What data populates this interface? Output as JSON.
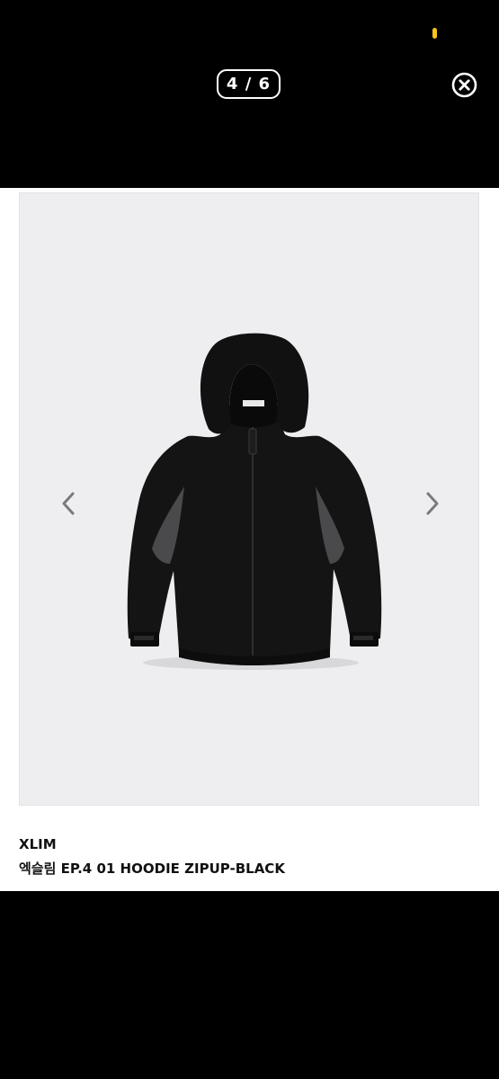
{
  "viewer": {
    "counter": "4 / 6",
    "current_index": 4,
    "total_images": 6
  },
  "icons": {
    "close": "close-circle-icon",
    "prev": "chevron-left-icon",
    "next": "chevron-right-icon",
    "product_image": "black-hoodie-zipup-image"
  },
  "product": {
    "brand": "XLIM",
    "name": "엑슬림 EP.4 01 HOODIE ZIPUP-BLACK"
  },
  "colors": {
    "background": "#000000",
    "content": "#ffffff",
    "photo_bg": "#eeeef0",
    "indicator": "#f5c518"
  }
}
